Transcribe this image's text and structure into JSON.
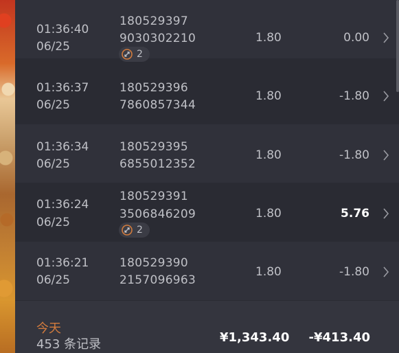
{
  "records": [
    {
      "time": "01:36:40",
      "date": "06/25",
      "id_line1": "180529397",
      "id_line2": "9030302210",
      "badge_count": "2",
      "stake": "1.80",
      "profit": "0.00",
      "win": false
    },
    {
      "time": "01:36:37",
      "date": "06/25",
      "id_line1": "180529396",
      "id_line2": "7860857344",
      "badge_count": "",
      "stake": "1.80",
      "profit": "-1.80",
      "win": false
    },
    {
      "time": "01:36:34",
      "date": "06/25",
      "id_line1": "180529395",
      "id_line2": "6855012352",
      "badge_count": "",
      "stake": "1.80",
      "profit": "-1.80",
      "win": false
    },
    {
      "time": "01:36:24",
      "date": "06/25",
      "id_line1": "180529391",
      "id_line2": "3506846209",
      "badge_count": "2",
      "stake": "1.80",
      "profit": "5.76",
      "win": true
    },
    {
      "time": "01:36:21",
      "date": "06/25",
      "id_line1": "180529390",
      "id_line2": "2157096963",
      "badge_count": "",
      "stake": "1.80",
      "profit": "-1.80",
      "win": false
    }
  ],
  "footer": {
    "today_label": "今天",
    "record_count": "453 条记录",
    "total_stake": "¥1,343.40",
    "total_profit": "-¥413.40"
  },
  "icons": {
    "row_chevron": "chevron-right-icon",
    "badge_icon": "free-spin-icon"
  },
  "colors": {
    "background": "#2a2b33",
    "row_alt": "#30313a",
    "footer_bg": "#34353e",
    "text": "#bfc0c6",
    "accent_today": "#d27b3d",
    "badge_bg": "#3b3c45"
  }
}
